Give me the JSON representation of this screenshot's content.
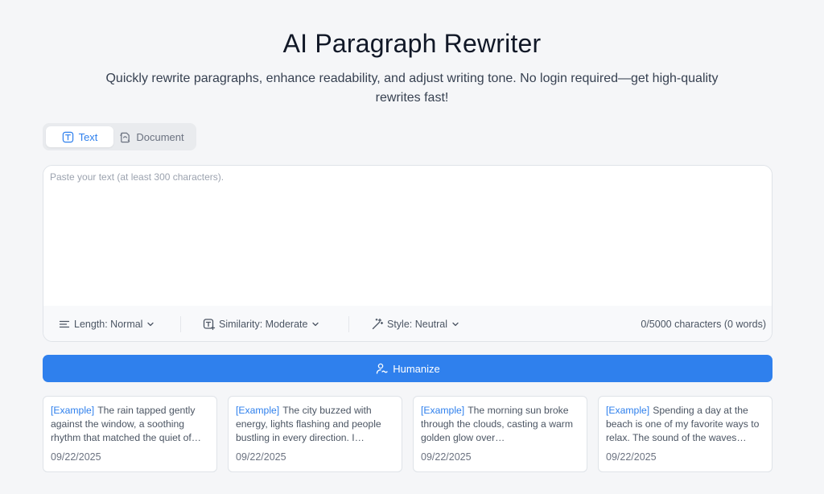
{
  "header": {
    "title": "AI Paragraph Rewriter",
    "subtitle": "Quickly rewrite paragraphs, enhance readability, and adjust writing tone. No login required—get high-quality rewrites fast!"
  },
  "mode_tabs": [
    {
      "label": "Text",
      "icon": "text-t-icon",
      "active": true
    },
    {
      "label": "Document",
      "icon": "document-icon",
      "active": false
    }
  ],
  "editor": {
    "placeholder": "Paste your text (at least 300 characters).",
    "value": ""
  },
  "options": {
    "length": {
      "label": "Length: Normal",
      "icon": "lines-icon"
    },
    "similarity": {
      "label": "Similarity: Moderate",
      "icon": "text-sparkle-icon"
    },
    "style": {
      "label": "Style: Neutral",
      "icon": "magic-wand-icon"
    },
    "char_count": "0/5000 characters (0 words)"
  },
  "humanize_button": {
    "label": "Humanize",
    "icon": "user-wave-icon"
  },
  "examples": [
    {
      "tag": "[Example]",
      "text": "The rain tapped gently against the window, a soothing rhythm that matched the quiet of…",
      "date": "09/22/2025"
    },
    {
      "tag": "[Example]",
      "text": "The city buzzed with energy, lights flashing and people bustling in every direction. I…",
      "date": "09/22/2025"
    },
    {
      "tag": "[Example]",
      "text": "The morning sun broke through the clouds, casting a warm golden glow over…",
      "date": "09/22/2025"
    },
    {
      "tag": "[Example]",
      "text": "Spending a day at the beach is one of my favorite ways to relax. The sound of the waves…",
      "date": "09/22/2025"
    }
  ],
  "colors": {
    "accent": "#2f80ed",
    "background": "#f5f6f8",
    "border": "#dfe3e8"
  }
}
